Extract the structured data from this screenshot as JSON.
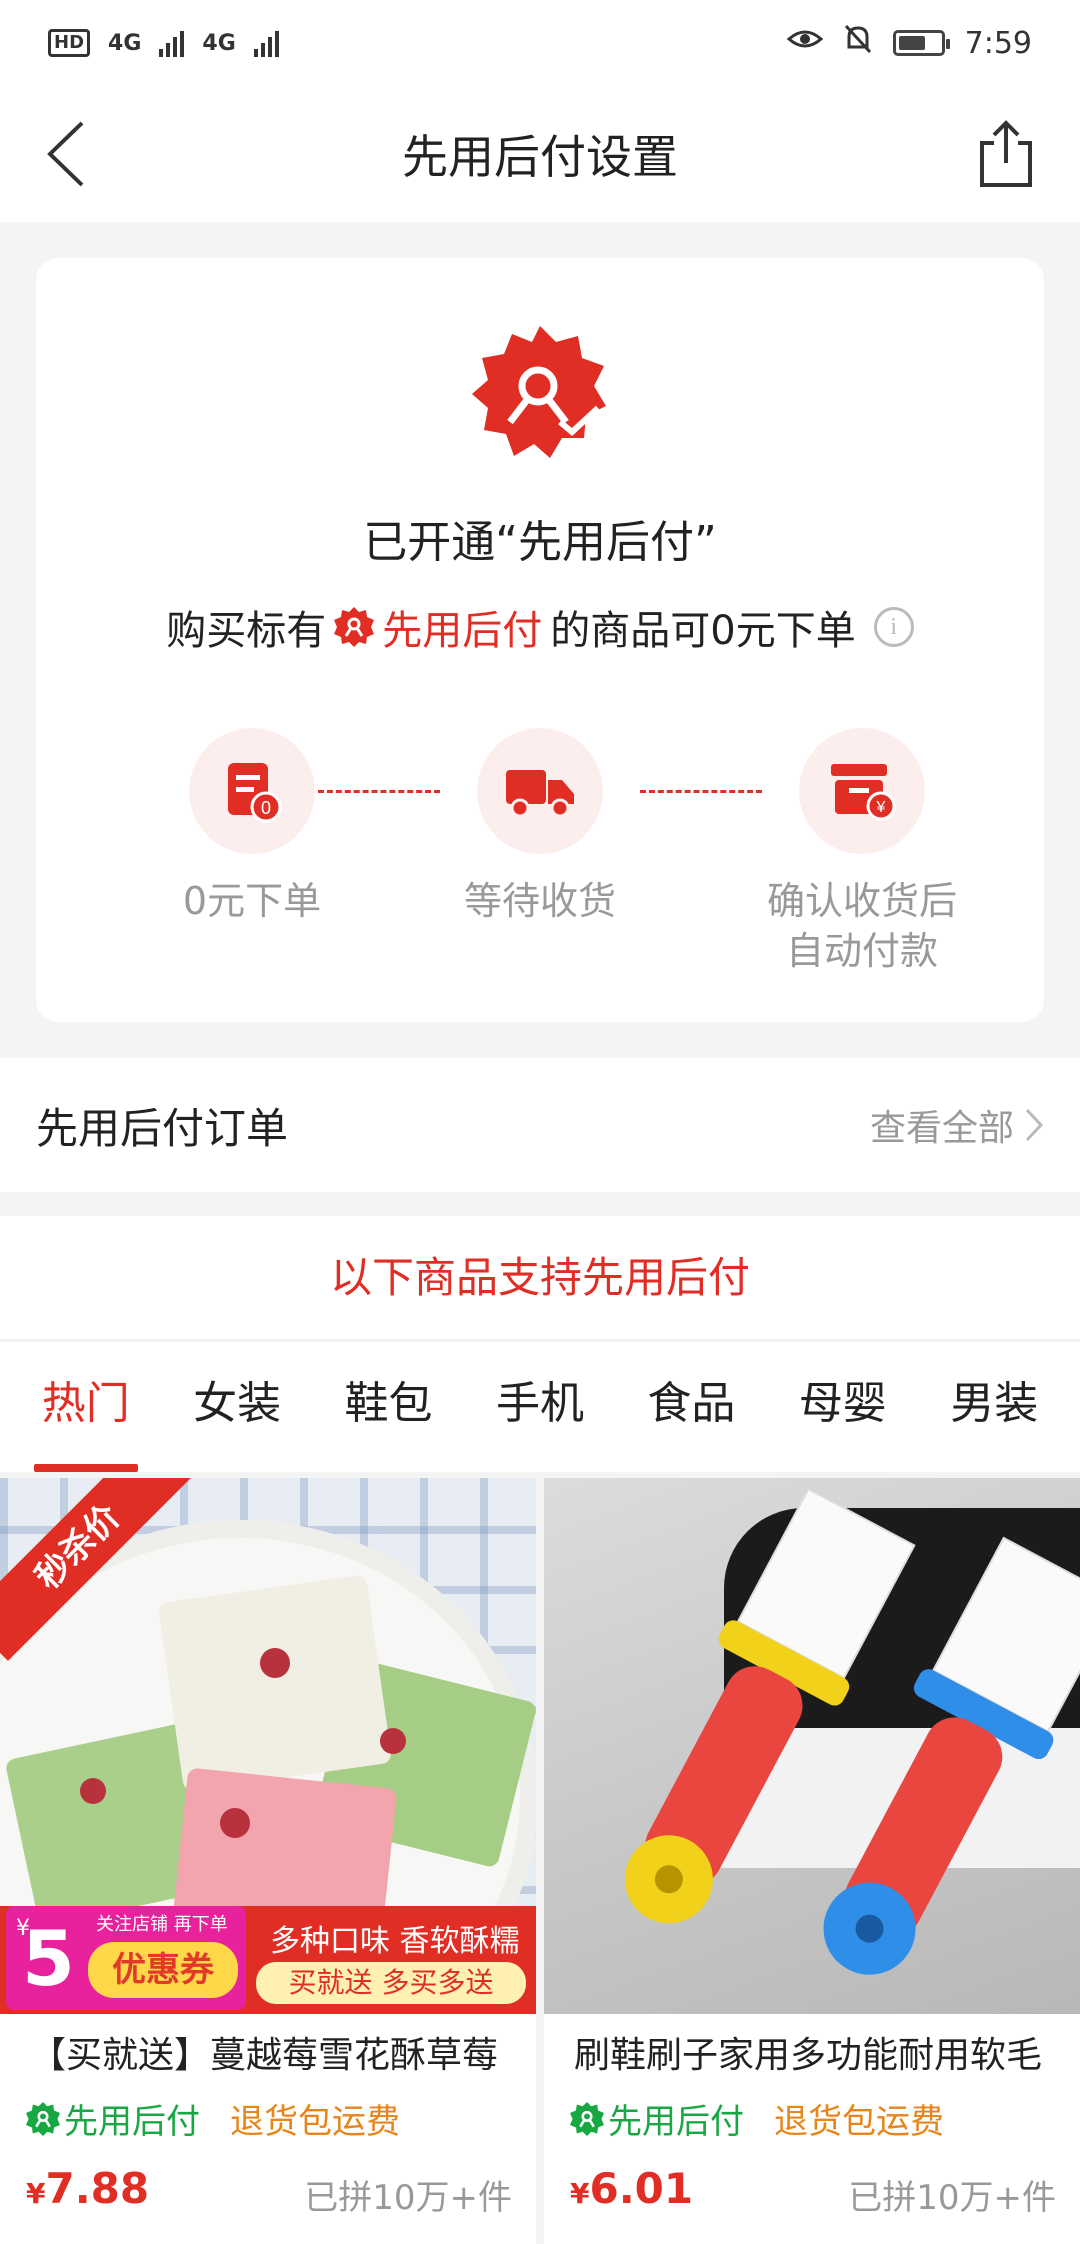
{
  "status_bar": {
    "hd": "HD",
    "net1": "4G",
    "net2": "4G",
    "time": "7:59"
  },
  "nav": {
    "title": "先用后付设置"
  },
  "card": {
    "opened_title": "已开通“先用后付”",
    "tip_prefix": "购买标有",
    "tip_mark": "先用后付",
    "tip_suffix": "的商品可0元下单",
    "info": "i",
    "steps": [
      {
        "label": "0元下单"
      },
      {
        "label": "等待收货"
      },
      {
        "label_line1": "确认收货后",
        "label_line2": "自动付款"
      }
    ]
  },
  "orders": {
    "title": "先用后付订单",
    "view_all": "查看全部"
  },
  "support_banner": "以下商品支持先用后付",
  "tabs": [
    "热门",
    "女装",
    "鞋包",
    "手机",
    "食品",
    "母婴",
    "男装"
  ],
  "active_tab": "热门",
  "products": [
    {
      "name": "【买就送】蔓越莓雪花酥草莓",
      "pay_tag": "先用后付",
      "return_tag": "退货包运费",
      "price_symbol": "¥",
      "price": "7.88",
      "sold": "已拼10万+件",
      "ribbon": "秒杀价",
      "coupon": {
        "yen": "¥",
        "amount": "5",
        "sub": "关注店铺 再下单",
        "label": "优惠券",
        "line1": "多种口味 香软酥糯",
        "line2": "买就送 多买多送"
      }
    },
    {
      "name": "刷鞋刷子家用多功能耐用软毛",
      "pay_tag": "先用后付",
      "return_tag": "退货包运费",
      "price_symbol": "¥",
      "price": "6.01",
      "sold": "已拼10万+件"
    }
  ],
  "colors": {
    "accent": "#e02e24",
    "green_tag": "#18a843",
    "orange_tag": "#e88418"
  }
}
